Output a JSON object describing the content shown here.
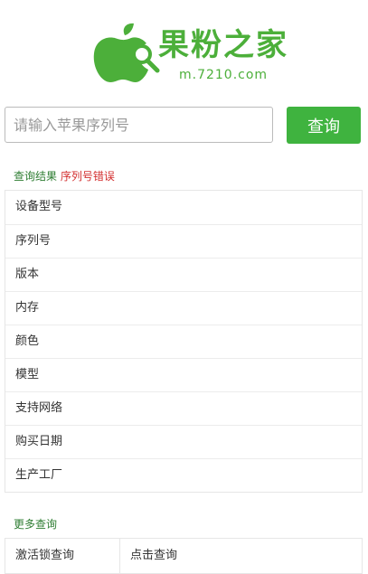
{
  "header": {
    "logo_text": "果粉之家",
    "domain": "m.7210.com",
    "brand_color": "#4caf3a"
  },
  "search": {
    "placeholder": "请输入苹果序列号",
    "value": "",
    "button_label": "查询",
    "button_color": "#3fb33f"
  },
  "result": {
    "title": "查询结果",
    "status": "序列号错误",
    "status_color": "#d32f2f",
    "rows": [
      {
        "label": "设备型号"
      },
      {
        "label": "序列号"
      },
      {
        "label": "版本"
      },
      {
        "label": "内存"
      },
      {
        "label": "颜色"
      },
      {
        "label": "模型"
      },
      {
        "label": "支持网络"
      },
      {
        "label": "购买日期"
      },
      {
        "label": "生产工厂"
      }
    ]
  },
  "more": {
    "title": "更多查询",
    "rows": [
      {
        "label": "激活锁查询",
        "link": "点击查询"
      }
    ]
  }
}
